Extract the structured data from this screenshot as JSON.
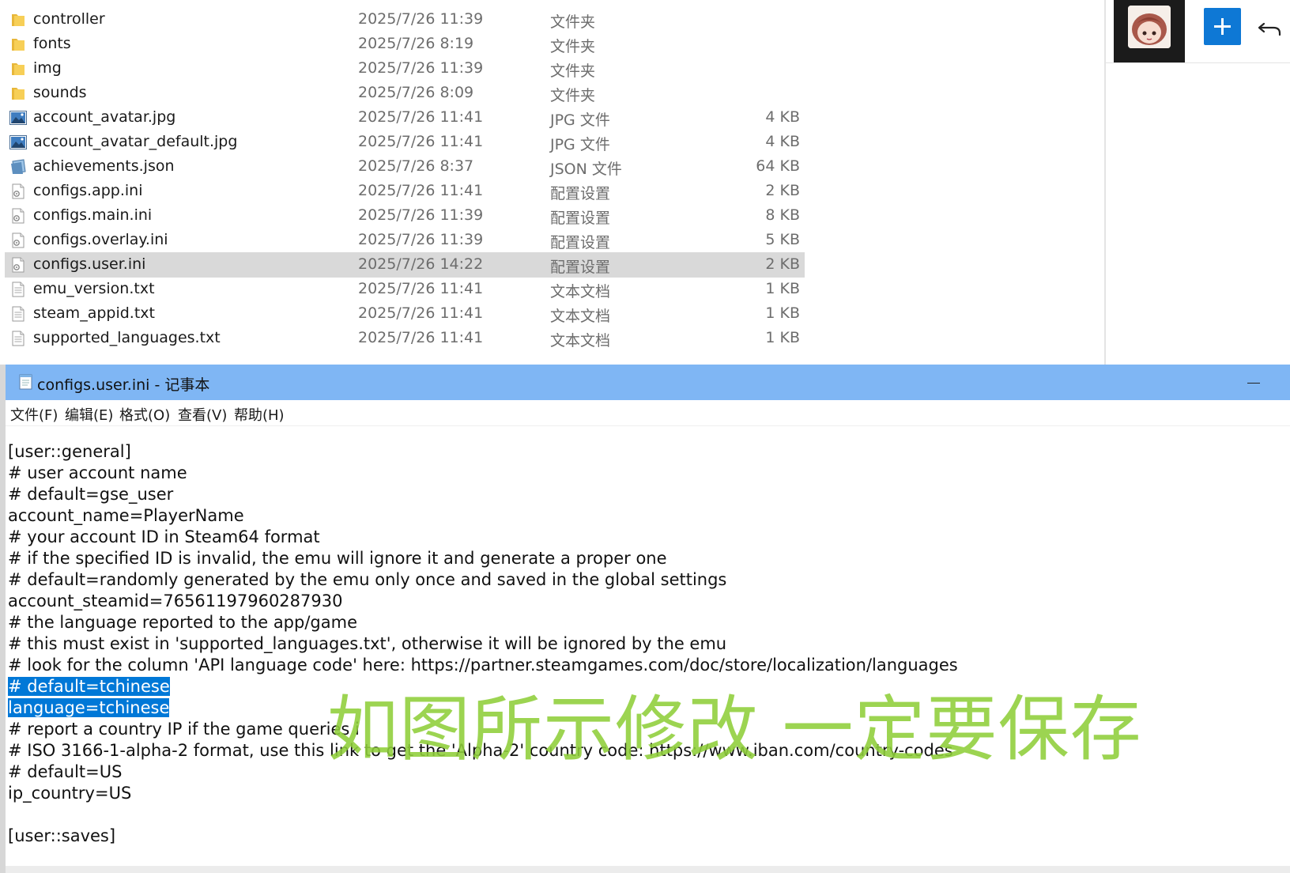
{
  "explorer": {
    "files": [
      {
        "name": "controller",
        "date": "2025/7/26 11:39",
        "type": "文件夹",
        "size": "",
        "icon": "folder-icon"
      },
      {
        "name": "fonts",
        "date": "2025/7/26 8:19",
        "type": "文件夹",
        "size": "",
        "icon": "folder-icon"
      },
      {
        "name": "img",
        "date": "2025/7/26 11:39",
        "type": "文件夹",
        "size": "",
        "icon": "folder-icon"
      },
      {
        "name": "sounds",
        "date": "2025/7/26 8:09",
        "type": "文件夹",
        "size": "",
        "icon": "folder-icon"
      },
      {
        "name": "account_avatar.jpg",
        "date": "2025/7/26 11:41",
        "type": "JPG 文件",
        "size": "4 KB",
        "icon": "image-file-icon"
      },
      {
        "name": "account_avatar_default.jpg",
        "date": "2025/7/26 11:41",
        "type": "JPG 文件",
        "size": "4 KB",
        "icon": "image-file-icon"
      },
      {
        "name": "achievements.json",
        "date": "2025/7/26 8:37",
        "type": "JSON 文件",
        "size": "64 KB",
        "icon": "json-file-icon"
      },
      {
        "name": "configs.app.ini",
        "date": "2025/7/26 11:41",
        "type": "配置设置",
        "size": "2 KB",
        "icon": "settings-file-icon"
      },
      {
        "name": "configs.main.ini",
        "date": "2025/7/26 11:39",
        "type": "配置设置",
        "size": "8 KB",
        "icon": "settings-file-icon"
      },
      {
        "name": "configs.overlay.ini",
        "date": "2025/7/26 11:39",
        "type": "配置设置",
        "size": "5 KB",
        "icon": "settings-file-icon"
      },
      {
        "name": "configs.user.ini",
        "date": "2025/7/26 14:22",
        "type": "配置设置",
        "size": "2 KB",
        "icon": "settings-file-icon",
        "selected": true
      },
      {
        "name": "emu_version.txt",
        "date": "2025/7/26 11:41",
        "type": "文本文档",
        "size": "1 KB",
        "icon": "text-file-icon"
      },
      {
        "name": "steam_appid.txt",
        "date": "2025/7/26 11:41",
        "type": "文本文档",
        "size": "1 KB",
        "icon": "text-file-icon"
      },
      {
        "name": "supported_languages.txt",
        "date": "2025/7/26 11:41",
        "type": "文本文档",
        "size": "1 KB",
        "icon": "text-file-icon"
      }
    ]
  },
  "side_panel": {
    "plus_icon": "plus-icon",
    "back_icon": "undo-arrow-icon",
    "accent_color": "#0e78d5"
  },
  "notepad": {
    "title": "configs.user.ini - 记事本",
    "menu": [
      "文件(F)",
      "编辑(E)",
      "格式(O)",
      "查看(V)",
      "帮助(H)"
    ],
    "lines": [
      {
        "text": "",
        "selected": false
      },
      {
        "text": "[user::general]",
        "selected": false
      },
      {
        "text": "# user account name",
        "selected": false
      },
      {
        "text": "# default=gse_user",
        "selected": false
      },
      {
        "text": "account_name=PlayerName",
        "selected": false
      },
      {
        "text": "# your account ID in Steam64 format",
        "selected": false
      },
      {
        "text": "# if the specified ID is invalid, the emu will ignore it and generate a proper one",
        "selected": false
      },
      {
        "text": "# default=randomly generated by the emu only once and saved in the global settings",
        "selected": false
      },
      {
        "text": "account_steamid=76561197960287930",
        "selected": false
      },
      {
        "text": "# the language reported to the app/game",
        "selected": false
      },
      {
        "text": "# this must exist in 'supported_languages.txt', otherwise it will be ignored by the emu",
        "selected": false
      },
      {
        "text": "# look for the column 'API language code' here: https://partner.steamgames.com/doc/store/localization/languages",
        "selected": false
      },
      {
        "text": "# default=tchinese",
        "selected": true
      },
      {
        "text": "language=tchinese",
        "selected": true
      },
      {
        "text": "# report a country IP if the game queries i",
        "selected": false
      },
      {
        "text": "# ISO 3166-1-alpha-2 format, use this link to get the 'Alpha-2' country code: https://www.iban.com/country-codes",
        "selected": false
      },
      {
        "text": "# default=US",
        "selected": false
      },
      {
        "text": "ip_country=US",
        "selected": false
      },
      {
        "text": "",
        "selected": false
      },
      {
        "text": "[user::saves]",
        "selected": false
      }
    ],
    "selection_color": "#0078d7",
    "titlebar_color": "#7fb6f4"
  },
  "caption": {
    "text": "如图所示修改 一定要保存",
    "color": "#8fcf3a"
  }
}
